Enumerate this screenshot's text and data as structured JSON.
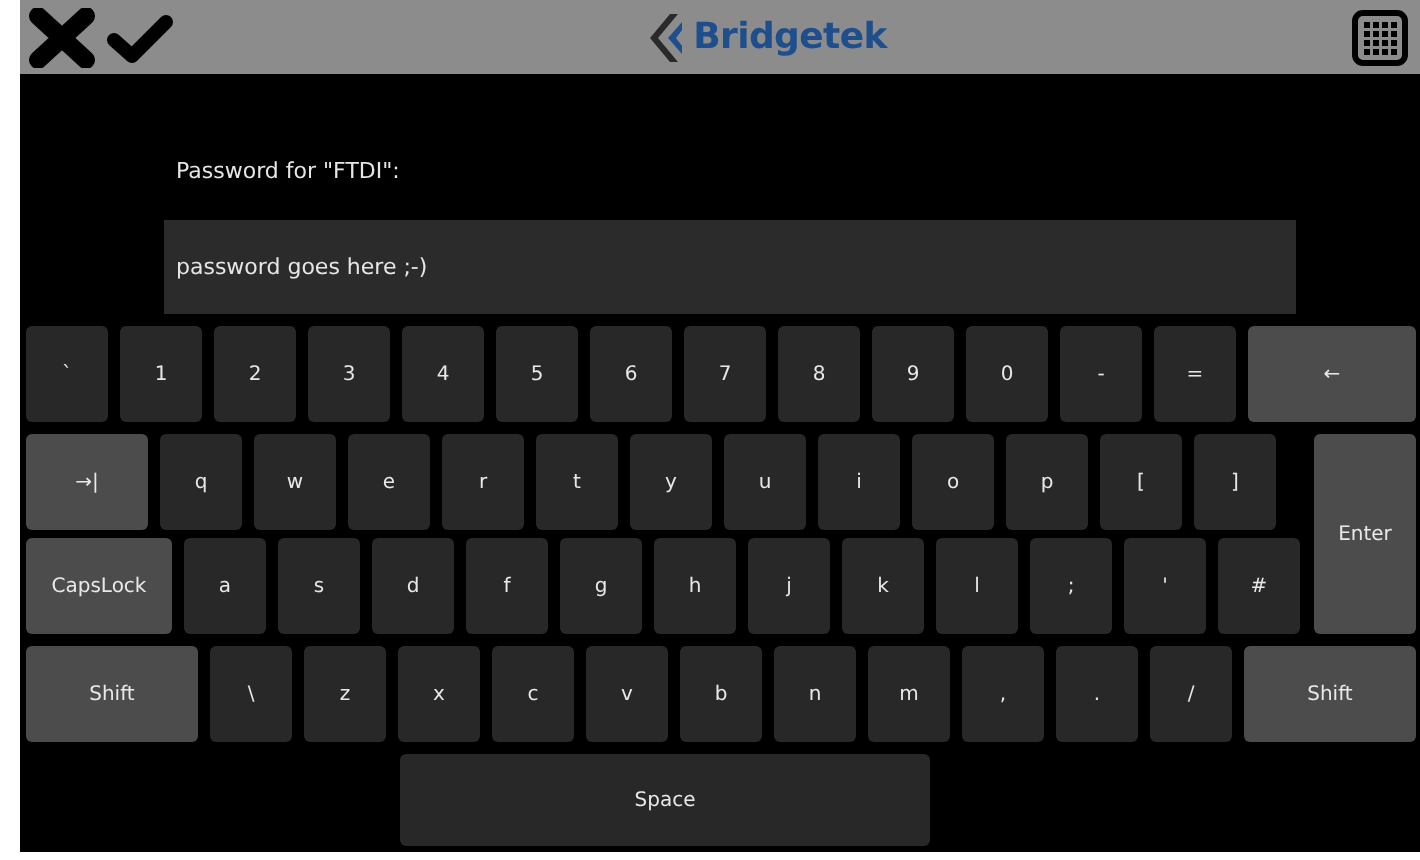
{
  "header": {
    "logo": {
      "text": "Bridgetek"
    }
  },
  "prompt": "Password for \"FTDI\":",
  "field": {
    "value": "password goes here ;-)"
  },
  "keyboard": {
    "rows": [
      [
        {
          "label": "`",
          "kind": "char"
        },
        {
          "label": "1",
          "kind": "char"
        },
        {
          "label": "2",
          "kind": "char"
        },
        {
          "label": "3",
          "kind": "char"
        },
        {
          "label": "4",
          "kind": "char"
        },
        {
          "label": "5",
          "kind": "char"
        },
        {
          "label": "6",
          "kind": "char"
        },
        {
          "label": "7",
          "kind": "char"
        },
        {
          "label": "8",
          "kind": "char"
        },
        {
          "label": "9",
          "kind": "char"
        },
        {
          "label": "0",
          "kind": "char"
        },
        {
          "label": "-",
          "kind": "char"
        },
        {
          "label": "=",
          "kind": "char"
        },
        {
          "label": "←",
          "kind": "wide"
        }
      ],
      [
        {
          "label": "→|",
          "kind": "wide"
        },
        {
          "label": "q",
          "kind": "char"
        },
        {
          "label": "w",
          "kind": "char"
        },
        {
          "label": "e",
          "kind": "char"
        },
        {
          "label": "r",
          "kind": "char"
        },
        {
          "label": "t",
          "kind": "char"
        },
        {
          "label": "y",
          "kind": "char"
        },
        {
          "label": "u",
          "kind": "char"
        },
        {
          "label": "i",
          "kind": "char"
        },
        {
          "label": "o",
          "kind": "char"
        },
        {
          "label": "p",
          "kind": "char"
        },
        {
          "label": "[",
          "kind": "char"
        },
        {
          "label": "]",
          "kind": "char"
        },
        {
          "label": "Enter",
          "kind": "enter"
        }
      ],
      [
        {
          "label": "CapsLock",
          "kind": "wide"
        },
        {
          "label": "a",
          "kind": "char"
        },
        {
          "label": "s",
          "kind": "char"
        },
        {
          "label": "d",
          "kind": "char"
        },
        {
          "label": "f",
          "kind": "char"
        },
        {
          "label": "g",
          "kind": "char"
        },
        {
          "label": "h",
          "kind": "char"
        },
        {
          "label": "j",
          "kind": "char"
        },
        {
          "label": "k",
          "kind": "char"
        },
        {
          "label": "l",
          "kind": "char"
        },
        {
          "label": ";",
          "kind": "char"
        },
        {
          "label": "'",
          "kind": "char"
        },
        {
          "label": "#",
          "kind": "char"
        }
      ],
      [
        {
          "label": "Shift",
          "kind": "wide"
        },
        {
          "label": "\\",
          "kind": "char"
        },
        {
          "label": "z",
          "kind": "char"
        },
        {
          "label": "x",
          "kind": "char"
        },
        {
          "label": "c",
          "kind": "char"
        },
        {
          "label": "v",
          "kind": "char"
        },
        {
          "label": "b",
          "kind": "char"
        },
        {
          "label": "n",
          "kind": "char"
        },
        {
          "label": "m",
          "kind": "char"
        },
        {
          "label": ",",
          "kind": "char"
        },
        {
          "label": ".",
          "kind": "char"
        },
        {
          "label": "/",
          "kind": "char"
        },
        {
          "label": "Shift",
          "kind": "wide"
        }
      ],
      [
        {
          "label": "Space",
          "kind": "space"
        }
      ]
    ]
  }
}
